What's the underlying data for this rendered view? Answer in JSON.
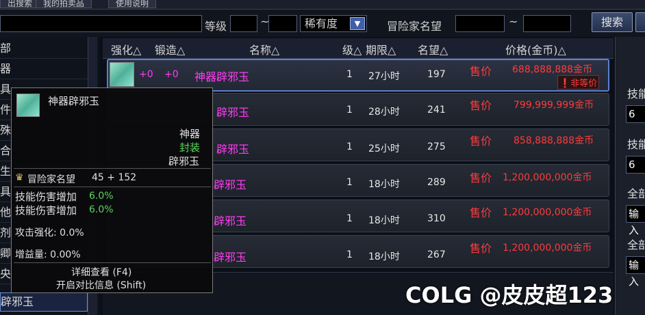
{
  "top_tabs": [
    "出搜索",
    "我的拍卖品",
    "使用说明"
  ],
  "search": {
    "level_label": "等级",
    "tilde1": "~",
    "rarity_value": "稀有度",
    "fame_label": "冒险家名望",
    "tilde2": "~",
    "search_button": "搜索"
  },
  "categories": [
    "部",
    "器",
    "具",
    "件",
    "殊",
    "合",
    "生",
    "具",
    "他",
    "剂",
    "卿",
    "央"
  ],
  "selected_category": "辟邪玉",
  "columns": [
    "强化△",
    "锻造△",
    "名称△",
    "级△",
    "期限△",
    "名望△",
    "价格(金币)△"
  ],
  "rows": [
    {
      "enhance": "+0",
      "forge": "+0",
      "name": "神器辟邪玉",
      "level": "1",
      "duration": "27小时",
      "fame": "197",
      "sell": "售价",
      "price": "688,888,888金币",
      "badge": "非等价"
    },
    {
      "name": "辟邪玉",
      "level": "1",
      "duration": "28小时",
      "fame": "241",
      "sell": "售价",
      "price": "799,999,999金币"
    },
    {
      "name": "辟邪玉",
      "level": "1",
      "duration": "25小时",
      "fame": "275",
      "sell": "售价",
      "price": "858,888,888金币"
    },
    {
      "name": "辟邪玉",
      "level": "1",
      "duration": "18小时",
      "fame": "289",
      "sell": "售价",
      "price": "1,200,000,000金币"
    },
    {
      "name": "辟邪玉",
      "level": "1",
      "duration": "18小时",
      "fame": "310",
      "sell": "售价",
      "price": "1,200,000,000金币"
    },
    {
      "name": "辟邪玉",
      "level": "1",
      "duration": "18小时",
      "fame": "267",
      "sell": "售价",
      "price": "1,200,000,000金币"
    }
  ],
  "right_panel": {
    "label1": "技能",
    "value1": "6",
    "label2": "技能",
    "value2": "6",
    "label3": "全部",
    "input3": "输入",
    "label4": "全部",
    "input4": "输入"
  },
  "tooltip": {
    "title": "神器辟邪玉",
    "rarity": "神器",
    "sealed": "封装",
    "type": "辟邪玉",
    "fame_label": "冒险家名望",
    "fame_value": "45 + 152",
    "stat1_label": "技能伤害增加",
    "stat1_value": "6.0%",
    "stat2_label": "技能伤害增加",
    "stat2_value": "6.0%",
    "stat3": "攻击强化: 0.0%",
    "stat4": "增益量: 0.00%",
    "detail": "详细查看 (F4)",
    "compare": "开启对比信息 (Shift)"
  },
  "watermark": "COLG @皮皮超123",
  "colors": {
    "artifact": "#ff3df0",
    "price": "#ff3b3b",
    "sealed": "#5cd65c"
  }
}
